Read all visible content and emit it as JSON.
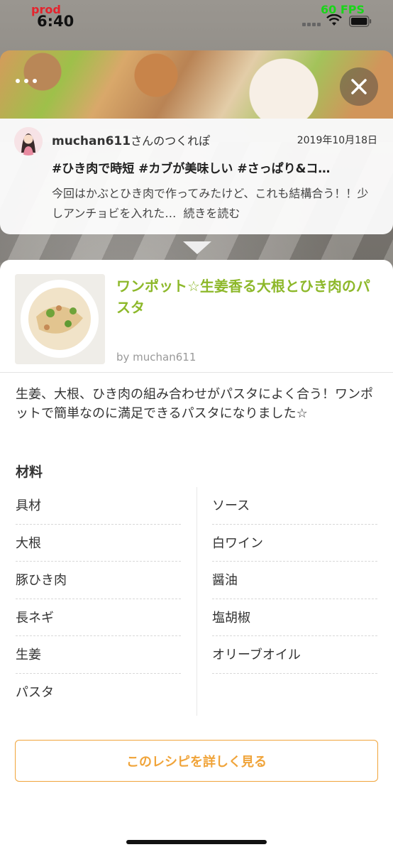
{
  "status_bar": {
    "env_label": "prod",
    "time": "6:40",
    "fps": "60 FPS"
  },
  "tsukurepo": {
    "author_name": "muchan611",
    "author_suffix": "さんのつくれぽ",
    "date": "2019年10月18日",
    "hashtags": "#ひき肉で時短 #カブが美味しい #さっぱり&コ…",
    "text": "今回はかぶとひき肉で作ってみたけど、これも結構合う！！少しアンチョビを入れた…",
    "read_more": "続きを読む"
  },
  "recipe": {
    "title": "ワンポット☆生姜香る大根とひき肉のパスタ",
    "author": "by muchan611",
    "description": "生姜、大根、ひき肉の組み合わせがパスタによく合う！ワンポットで簡単なのに満足できるパスタになりました☆",
    "ingredients_heading": "材料",
    "ingredients_left": [
      "具材",
      "大根",
      "豚ひき肉",
      "長ネギ",
      "生姜",
      "パスタ"
    ],
    "ingredients_right": [
      "ソース",
      "白ワイン",
      "醤油",
      "塩胡椒",
      "オリーブオイル"
    ],
    "view_button_label": "このレシピを詳しく見る"
  },
  "icons": {
    "close": "close-icon",
    "more": "more-icon",
    "wifi": "wifi-icon",
    "battery": "battery-icon"
  },
  "colors": {
    "title_green": "#8db82a",
    "button_orange": "#f0a43a",
    "env_red": "#e5232d",
    "fps_green": "#19d619"
  }
}
